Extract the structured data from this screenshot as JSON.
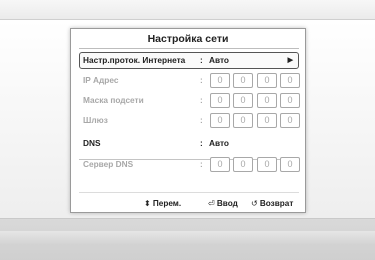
{
  "dialog": {
    "title": "Настройка сети"
  },
  "rows": [
    {
      "label": "Настр.проток. Интернета",
      "colon": ":",
      "value": "Авто"
    },
    {
      "label": "IP Адрес",
      "colon": ":",
      "octets": [
        "0",
        "0",
        "0",
        "0"
      ]
    },
    {
      "label": "Маска подсети",
      "colon": ":",
      "octets": [
        "0",
        "0",
        "0",
        "0"
      ]
    },
    {
      "label": "Шлюз",
      "colon": ":",
      "octets": [
        "0",
        "0",
        "0",
        "0"
      ]
    },
    {
      "label": "DNS",
      "colon": ":",
      "value": "Авто"
    },
    {
      "label": "Сервер DNS",
      "colon": ":",
      "octets": [
        "0",
        "0",
        "0",
        "0"
      ]
    }
  ],
  "footer": {
    "move_label": "Перем.",
    "enter_label": "Ввод",
    "back_label": "Возврат"
  },
  "icons": {
    "move": "up-down-arrows-icon",
    "enter": "enter-icon",
    "back": "return-icon",
    "submenu": "chevron-right-icon"
  },
  "colors": {
    "active_text": "#222222",
    "disabled_text": "#a8a8a8",
    "dialog_bg": "#ffffff",
    "backdrop": "#e7e7e7"
  }
}
